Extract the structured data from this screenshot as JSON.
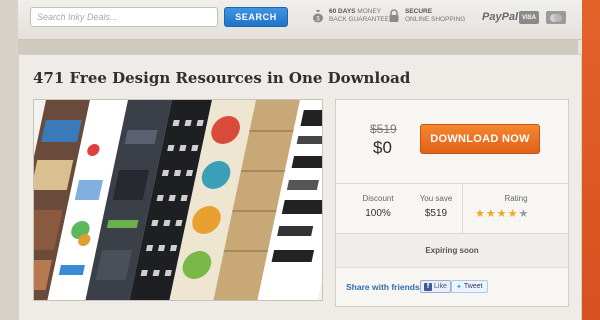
{
  "search": {
    "placeholder": "Search Inky Deals...",
    "button_label": "SEARCH"
  },
  "badges": {
    "days": {
      "line1": "60 DAYS",
      "line1_rest": " MONEY",
      "line2": "BACK GUARANTEE",
      "icon": "money-bag-icon"
    },
    "secure": {
      "line1": "SECURE",
      "line2": "ONLINE SHOPPING",
      "icon": "lock-icon"
    }
  },
  "payments": {
    "paypal": "PayPal",
    "visa": "VISA",
    "mastercard": "MC"
  },
  "deal": {
    "title": "471 Free Design Resources in One Download",
    "old_price": "$519",
    "new_price": "$0",
    "download_label": "DOWNLOAD NOW",
    "discount_label": "Discount",
    "discount_value": "100%",
    "save_label": "You save",
    "save_value": "$519",
    "rating_label": "Rating",
    "rating": 4,
    "rating_max": 5,
    "expiring": "Expiring soon",
    "share_label": "Share with friends",
    "like_label": "Like",
    "tweet_label": "Tweet"
  },
  "colors": {
    "search_button": "#2a80d4",
    "download_button": "#ee7224",
    "star_on": "#f0a81c",
    "star_off": "#9a9a9a",
    "share_link": "#2e6fb0"
  }
}
